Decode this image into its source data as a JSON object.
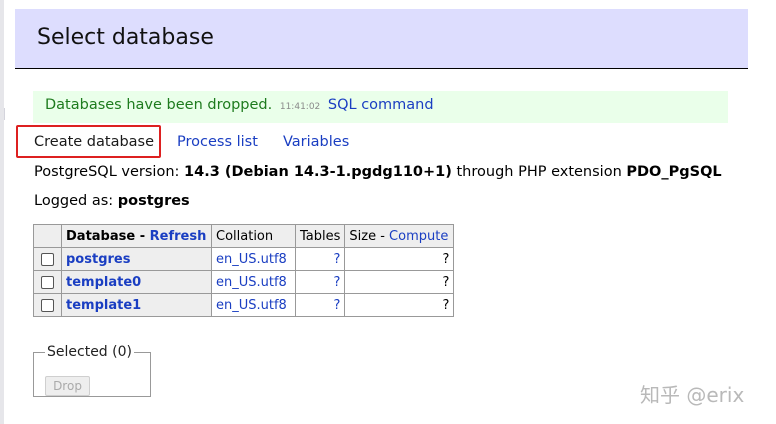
{
  "header": {
    "title": "Select database"
  },
  "message": {
    "text": "Databases have been dropped.",
    "time": "11:41:02",
    "link": "SQL command"
  },
  "links": {
    "create_database": "Create database",
    "process_list": "Process list",
    "variables": "Variables"
  },
  "version": {
    "prefix": "PostgreSQL version:",
    "version": "14.3 (Debian 14.3-1.pgdg110+1)",
    "middle": "through PHP extension",
    "extension": "PDO_PgSQL"
  },
  "logged": {
    "prefix": "Logged as:",
    "user": "postgres"
  },
  "table": {
    "headers": {
      "database": "Database",
      "refresh": "Refresh",
      "collation": "Collation",
      "tables": "Tables",
      "size": "Size",
      "compute": "Compute"
    },
    "rows": [
      {
        "name": "postgres",
        "collation": "en_US.utf8",
        "tables": "?",
        "size": "?"
      },
      {
        "name": "template0",
        "collation": "en_US.utf8",
        "tables": "?",
        "size": "?"
      },
      {
        "name": "template1",
        "collation": "en_US.utf8",
        "tables": "?",
        "size": "?"
      }
    ]
  },
  "selected": {
    "legend": "Selected (0)",
    "drop": "Drop"
  },
  "watermark": "知乎 @erix",
  "colors": {
    "header_bg": "#ddddfe",
    "message_bg": "#eaffea",
    "message_text": "#1e7b1e",
    "link": "#1a3ec2",
    "highlight_border": "#dd2020"
  }
}
